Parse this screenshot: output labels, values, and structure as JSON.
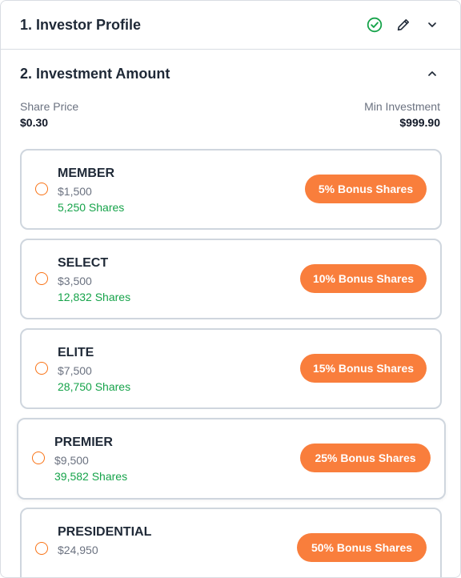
{
  "sections": [
    {
      "title": "1. Investor Profile",
      "completed": true,
      "icons": [
        "check-circle-icon",
        "pencil-icon",
        "chevron-down-icon"
      ]
    },
    {
      "title": "2. Investment Amount",
      "icons": [
        "chevron-up-icon"
      ]
    }
  ],
  "meta": {
    "share_price_label": "Share Price",
    "share_price_value": "$0.30",
    "min_investment_label": "Min Investment",
    "min_investment_value": "$999.90"
  },
  "tiers": [
    {
      "name": "MEMBER",
      "amount": "$1,500",
      "shares": "5,250 Shares",
      "bonus": "5% Bonus Shares",
      "selected": false
    },
    {
      "name": "SELECT",
      "amount": "$3,500",
      "shares": "12,832 Shares",
      "bonus": "10% Bonus Shares",
      "selected": false
    },
    {
      "name": "ELITE",
      "amount": "$7,500",
      "shares": "28,750 Shares",
      "bonus": "15% Bonus Shares",
      "selected": false
    },
    {
      "name": "PREMIER",
      "amount": "$9,500",
      "shares": "39,582 Shares",
      "bonus": "25% Bonus Shares",
      "selected": false
    },
    {
      "name": "PRESIDENTIAL",
      "amount": "$24,950",
      "shares": "",
      "bonus": "50% Bonus Shares",
      "selected": false
    }
  ],
  "colors": {
    "accent": "#f97e3c",
    "success": "#16a34a",
    "border": "#cfd6de",
    "muted_text": "#6b7280"
  }
}
